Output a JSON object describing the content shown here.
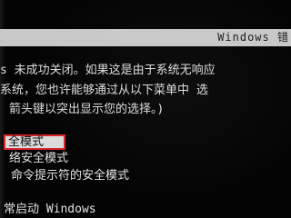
{
  "header": {
    "title": "Windows 错"
  },
  "message": {
    "line1": "s 未成功关闭。如果这是由于系统无响应",
    "line2": "系统，您也许能够通过从以下菜单中 选",
    "line3": "箭头键以突出显示您的选择。)"
  },
  "menu": {
    "items": [
      {
        "label": "全模式",
        "selected": true
      },
      {
        "label": "络安全模式",
        "selected": false
      },
      {
        "label": "命令提示符的安全模式",
        "selected": false
      },
      {
        "label": "常启动 Windows",
        "selected": false
      }
    ]
  },
  "colors": {
    "background": "#040404",
    "header_bar": "#c8c8c8",
    "text": "#dedede",
    "selection_bg": "#dcdcdc",
    "selection_border": "#d6262a"
  }
}
